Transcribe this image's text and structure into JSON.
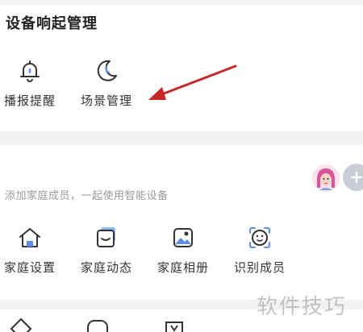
{
  "device_section": {
    "title": "设备响起管理",
    "items": [
      {
        "label": "播报提醒",
        "icon": "bell-icon"
      },
      {
        "label": "场景管理",
        "icon": "moon-icon"
      }
    ]
  },
  "family_section": {
    "hint": "添加家庭成员，一起使用智能设备",
    "items": [
      {
        "label": "家庭设置",
        "icon": "home-icon"
      },
      {
        "label": "家庭动态",
        "icon": "status-icon"
      },
      {
        "label": "家庭相册",
        "icon": "photo-album-icon"
      },
      {
        "label": "识别成员",
        "icon": "face-scan-icon"
      }
    ]
  },
  "watermark": "软件技巧",
  "colors": {
    "arrow": "#c62828",
    "hint": "#9a9aa0",
    "band": "#f2f2f5"
  }
}
